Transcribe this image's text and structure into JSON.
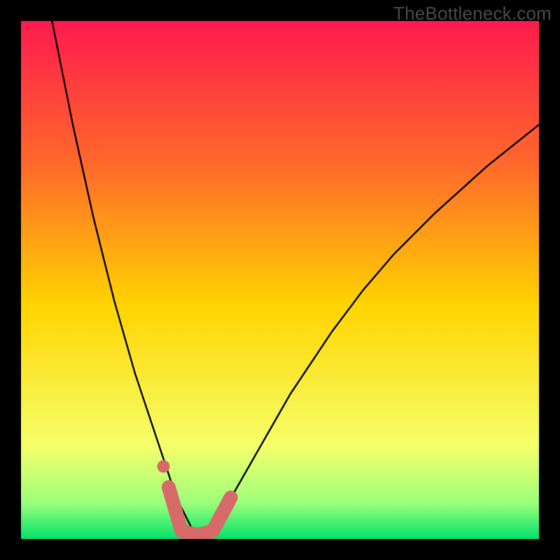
{
  "watermark": "TheBottleneck.com",
  "colors": {
    "frame": "#000000",
    "grad_top": "#ff1a4e",
    "grad_mid1": "#ff6a2a",
    "grad_mid2": "#ffd400",
    "grad_low1": "#f6ff6a",
    "grad_low2": "#9cff7a",
    "grad_bottom": "#00e36b",
    "curve": "#000000",
    "marker": "#d76a69"
  },
  "chart_data": {
    "type": "line",
    "title": "",
    "xlabel": "",
    "ylabel": "",
    "xlim": [
      0,
      100
    ],
    "ylim": [
      0,
      100
    ],
    "series": [
      {
        "name": "bottleneck_curve",
        "x": [
          6,
          8,
          10,
          12,
          14,
          16,
          18,
          20,
          22,
          24,
          26,
          28,
          30,
          31,
          32,
          33,
          34,
          35,
          36,
          38,
          40,
          44,
          48,
          52,
          56,
          60,
          66,
          72,
          80,
          90,
          100
        ],
        "y": [
          100,
          90,
          80,
          71,
          62,
          54,
          46,
          39,
          32,
          26,
          20,
          14,
          8,
          6,
          4,
          2,
          1,
          1,
          2,
          4,
          7,
          14,
          21,
          28,
          34,
          40,
          48,
          55,
          63,
          72,
          80
        ]
      }
    ],
    "markers": [
      {
        "name": "peak_segment_left_end",
        "x": 28.5,
        "y": 10
      },
      {
        "name": "peak_segment_bottom_left",
        "x": 31,
        "y": 1.5
      },
      {
        "name": "peak_segment_bottom_mid",
        "x": 34,
        "y": 0.8
      },
      {
        "name": "peak_segment_bottom_right",
        "x": 37,
        "y": 1.5
      },
      {
        "name": "peak_segment_right_end",
        "x": 40.5,
        "y": 8
      },
      {
        "name": "isolated_dot",
        "x": 27.5,
        "y": 14
      }
    ],
    "annotations": []
  }
}
